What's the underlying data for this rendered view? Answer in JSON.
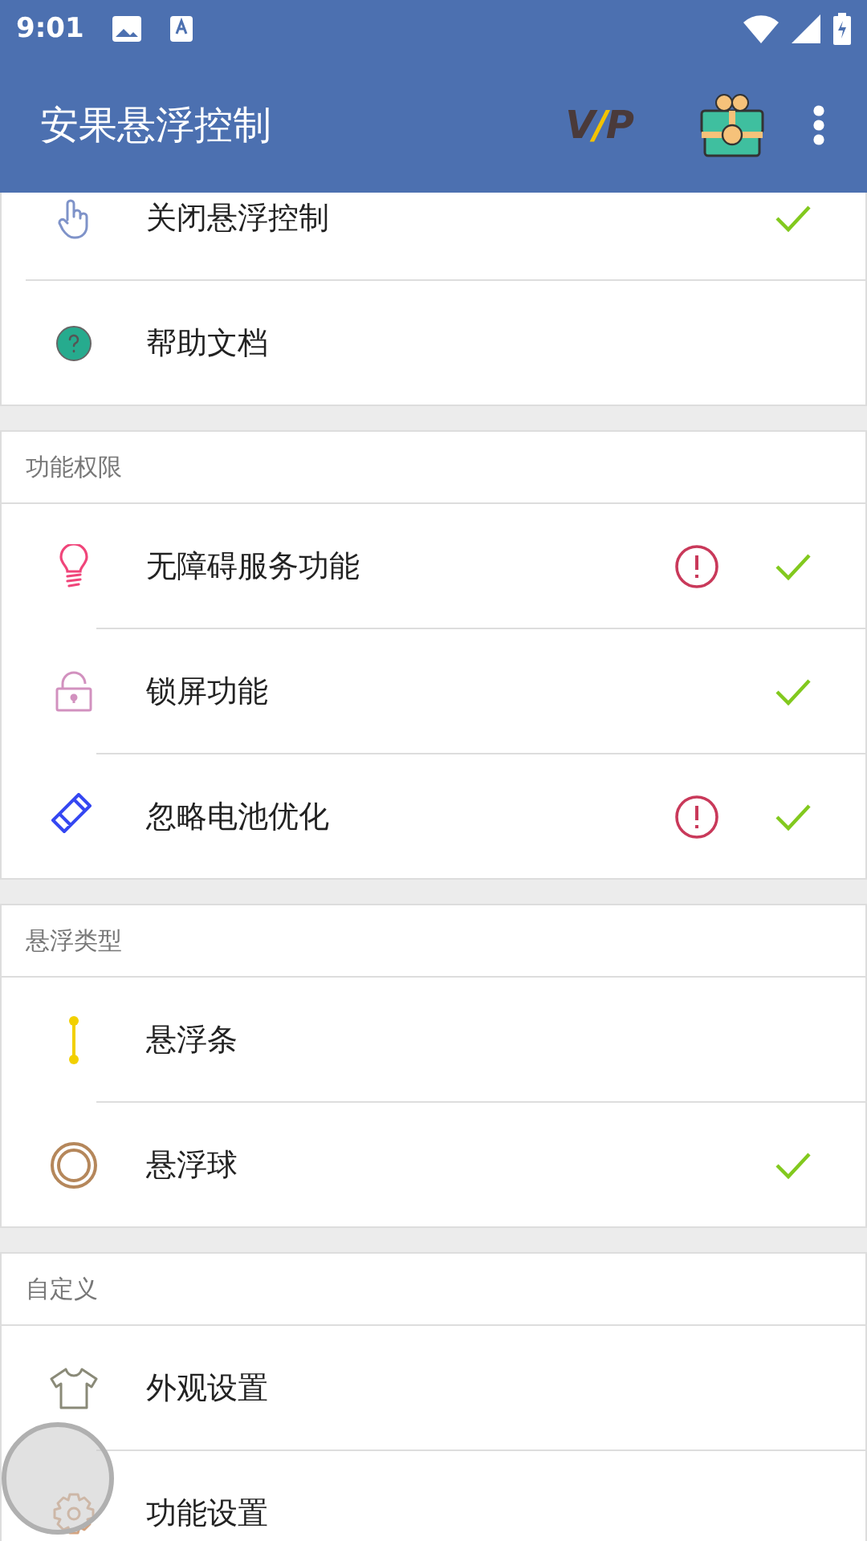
{
  "status_bar": {
    "time": "9:01"
  },
  "app_bar": {
    "title": "安果悬浮控制",
    "vip": [
      "V",
      "/",
      "P"
    ]
  },
  "sections": [
    {
      "rows": [
        {
          "kind": "touch",
          "label": "关闭悬浮控制",
          "warning": false,
          "checked": true
        },
        {
          "kind": "help",
          "label": "帮助文档",
          "warning": false,
          "checked": false
        }
      ]
    },
    {
      "header": "功能权限",
      "rows": [
        {
          "kind": "bulb",
          "label": "无障碍服务功能",
          "warning": true,
          "checked": true
        },
        {
          "kind": "lock",
          "label": "锁屏功能",
          "warning": false,
          "checked": true
        },
        {
          "kind": "battery",
          "label": "忽略电池优化",
          "warning": true,
          "checked": true
        }
      ]
    },
    {
      "header": "悬浮类型",
      "rows": [
        {
          "kind": "bar",
          "label": "悬浮条",
          "warning": false,
          "checked": false
        },
        {
          "kind": "ball",
          "label": "悬浮球",
          "warning": false,
          "checked": true
        }
      ]
    },
    {
      "header": "自定义",
      "rows": [
        {
          "kind": "shirt",
          "label": "外观设置",
          "warning": false,
          "checked": false
        },
        {
          "kind": "gear",
          "label": "功能设置",
          "warning": false,
          "checked": false
        }
      ]
    }
  ]
}
